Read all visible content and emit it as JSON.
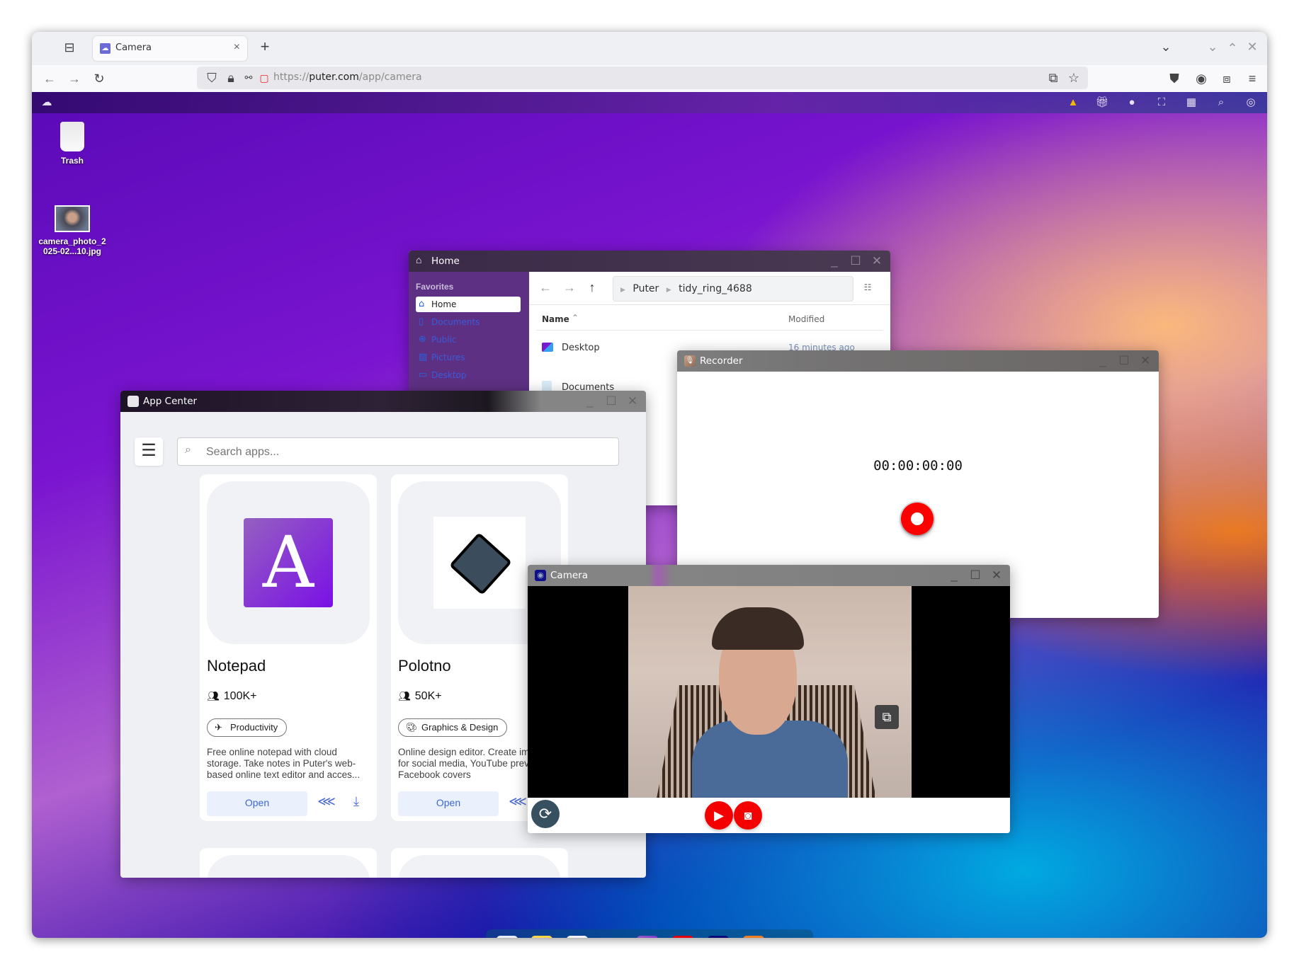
{
  "browser": {
    "tabs": [
      {
        "title": "Camera",
        "favicon": "puter-icon",
        "active": true
      }
    ],
    "new_tab_label": "+",
    "url": {
      "scheme": "https://",
      "host": "puter.com",
      "path": "/app/camera"
    },
    "toolbar_icons": [
      "back-icon",
      "forward-icon",
      "reload-icon",
      "shield-icon",
      "lock-icon",
      "permissions-icon",
      "camera-sharing-icon",
      "picture-in-picture-icon",
      "bookmark-star-icon",
      "pocket-icon",
      "account-icon",
      "extensions-icon",
      "menu-icon"
    ],
    "window_controls": [
      "tab-list-icon",
      "minimize-icon",
      "maximize-icon",
      "close-icon"
    ]
  },
  "topbar": {
    "logo": "puter-logo-icon",
    "icons": [
      "warning-icon",
      "gift-icon",
      "github-icon",
      "fullscreen-icon",
      "qr-code-icon",
      "search-icon",
      "user-icon"
    ],
    "warning_color": "#f5b800"
  },
  "desktop": {
    "items": [
      {
        "label": "Trash",
        "icon": "trash-icon"
      },
      {
        "label": "camera_photo_2\n025-02...10.jpg",
        "icon": "image-thumbnail"
      }
    ]
  },
  "home_window": {
    "title": "Home",
    "sidebar": {
      "heading": "Favorites",
      "items": [
        {
          "label": "Home",
          "icon": "home-icon",
          "active": true
        },
        {
          "label": "Documents",
          "icon": "document-icon"
        },
        {
          "label": "Public",
          "icon": "globe-icon"
        },
        {
          "label": "Pictures",
          "icon": "picture-icon"
        },
        {
          "label": "Desktop",
          "icon": "monitor-icon"
        }
      ]
    },
    "breadcrumb": [
      "Puter",
      "tidy_ring_4688"
    ],
    "columns": {
      "name": "Name",
      "modified": "Modified"
    },
    "rows": [
      {
        "name": "Desktop",
        "modified": "16 minutes ago"
      },
      {
        "name": "Documents",
        "modified": ""
      }
    ]
  },
  "app_center": {
    "title": "App Center",
    "search_placeholder": "Search apps...",
    "apps": [
      {
        "name": "Notepad",
        "users": "100K+",
        "category": "Productivity",
        "description": "Free online notepad with cloud storage. Take notes in Puter's web-based online text editor and acces...",
        "open_label": "Open",
        "icon_color": "#7b2fe0"
      },
      {
        "name": "Polotno",
        "users": "50K+",
        "category": "Graphics & Design",
        "description": "Online design editor. Create images for social media, YouTube previews, Facebook covers",
        "open_label": "Open",
        "icon_color": "#3b4d5c"
      }
    ]
  },
  "recorder": {
    "title": "Recorder",
    "time": "00:00:00:00",
    "record_color": "#ff0000"
  },
  "camera": {
    "title": "Camera",
    "controls": [
      "switch-camera-icon",
      "record-video-icon",
      "take-photo-icon"
    ],
    "pip_label": "picture-in-picture-icon",
    "accent": "#f50000"
  },
  "dock": {
    "items": [
      {
        "name": "app-launcher",
        "running": false
      },
      {
        "name": "files",
        "running": true
      },
      {
        "name": "app-center",
        "running": true
      },
      {
        "name": "dev-center",
        "running": false
      },
      {
        "name": "notepad",
        "running": false
      },
      {
        "name": "code-editor",
        "running": false
      },
      {
        "name": "camera",
        "running": true
      },
      {
        "name": "recorder",
        "running": true
      },
      {
        "name": "trash",
        "running": false
      }
    ]
  }
}
